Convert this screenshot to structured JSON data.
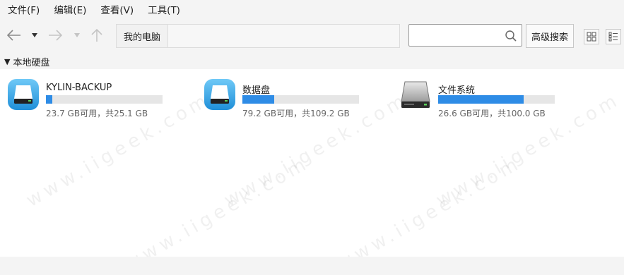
{
  "menubar": {
    "items": [
      {
        "label": "文件(F)"
      },
      {
        "label": "编辑(E)"
      },
      {
        "label": "查看(V)"
      },
      {
        "label": "工具(T)"
      }
    ]
  },
  "toolbar": {
    "back_icon": "arrow-left-icon",
    "dropdown_icon": "triangle-down-icon",
    "forward_icon": "arrow-right-icon",
    "up_icon": "arrow-up-icon",
    "breadcrumb": [
      {
        "label": "我的电脑"
      }
    ],
    "search": {
      "value": "",
      "placeholder": "",
      "icon": "search-icon"
    },
    "advanced_search_label": "高级搜索",
    "view_icons": [
      "icon-view-icon",
      "list-view-icon"
    ]
  },
  "section": {
    "title": "本地硬盘",
    "expanded": true
  },
  "drives": [
    {
      "name": "KYLIN-BACKUP",
      "info": "23.7 GB可用，共25.1 GB",
      "used_fraction": 0.056,
      "icon": "blue-disk-icon"
    },
    {
      "name": "数据盘",
      "info": "79.2 GB可用，共109.2 GB",
      "used_fraction": 0.275,
      "icon": "blue-disk-icon"
    },
    {
      "name": "文件系统",
      "info": "26.6 GB可用，共100.0 GB",
      "used_fraction": 0.734,
      "icon": "hard-drive-icon"
    }
  ],
  "watermark": "www.iigeek.com",
  "colors": {
    "accent": "#2e8ce6",
    "bar_bg": "#e6e6e6",
    "background": "#ffffff",
    "chrome": "#f4f4f4"
  }
}
